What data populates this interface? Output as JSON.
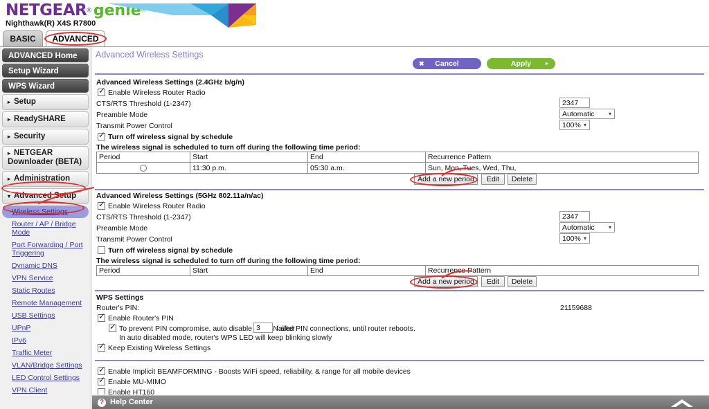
{
  "brand": {
    "netgear": "NETGEAR",
    "reg": "®",
    "genie": "genie",
    "genie_reg": "®",
    "model": "Nighthawk(R) X4S R7800",
    "purple": "#6c2f91",
    "green": "#5cb531"
  },
  "tabs": [
    {
      "label": "BASIC",
      "active": false
    },
    {
      "label": "ADVANCED",
      "active": true
    }
  ],
  "sidebar": {
    "buttons": [
      {
        "label": "ADVANCED Home"
      },
      {
        "label": "Setup Wizard"
      },
      {
        "label": "WPS Wizard"
      }
    ],
    "groups": [
      {
        "label": "Setup",
        "arrow": "▸",
        "expanded": false
      },
      {
        "label": "ReadySHARE",
        "arrow": "▸",
        "expanded": false
      },
      {
        "label": "Security",
        "arrow": "▸",
        "expanded": false
      },
      {
        "label": "NETGEAR Downloader (BETA)",
        "arrow": "▸",
        "expanded": false
      },
      {
        "label": "Administration",
        "arrow": "▸",
        "expanded": false
      },
      {
        "label": "Advanced Setup",
        "arrow": "▾",
        "expanded": true
      }
    ],
    "sub_items": [
      {
        "label": "Wireless Settings",
        "active": true
      },
      {
        "label": "Router / AP / Bridge Mode",
        "active": false
      },
      {
        "label": "Port Forwarding / Port Triggering",
        "active": false
      },
      {
        "label": "Dynamic DNS",
        "active": false
      },
      {
        "label": "VPN Service",
        "active": false
      },
      {
        "label": "Static Routes",
        "active": false
      },
      {
        "label": "Remote Management",
        "active": false
      },
      {
        "label": "USB Settings",
        "active": false
      },
      {
        "label": "UPnP",
        "active": false
      },
      {
        "label": "IPv6",
        "active": false
      },
      {
        "label": "Traffic Meter",
        "active": false
      },
      {
        "label": "VLAN/Bridge Settings",
        "active": false
      },
      {
        "label": "LED Control Settings",
        "active": false
      },
      {
        "label": "VPN Client",
        "active": false
      }
    ]
  },
  "page": {
    "title": "Advanced Wireless Settings",
    "cancel_label": "Cancel",
    "cancel_icon": "✖",
    "apply_label": "Apply",
    "apply_icon": "▸",
    "accent_purple": "#8d86c9",
    "cancel_color": "#6f64c4",
    "apply_color": "#7bba2e"
  },
  "band24": {
    "heading": "Advanced Wireless Settings (2.4GHz b/g/n)",
    "enable_radio": {
      "label": "Enable Wireless Router Radio",
      "checked": true
    },
    "cts_rts": {
      "label": "CTS/RTS Threshold (1-2347)",
      "value": "2347"
    },
    "preamble": {
      "label": "Preamble Mode",
      "value": "Automatic"
    },
    "power": {
      "label": "Transmit Power Control",
      "value": "100%"
    },
    "schedule_toggle": {
      "label": "Turn off wireless signal by schedule",
      "checked": true
    },
    "schedule_note": "The wireless signal is scheduled to turn off during the following time period:",
    "table": {
      "headers": [
        "Period",
        "Start",
        "End",
        "Recurrence Pattern"
      ],
      "rows": [
        {
          "period": "",
          "start": "11:30 p.m.",
          "end": "05:30 a.m.",
          "recurrence": "Sun, Mon, Tues, Wed, Thu,"
        }
      ]
    },
    "buttons": {
      "add": "Add a new period",
      "edit": "Edit",
      "delete": "Delete"
    }
  },
  "band5": {
    "heading": "Advanced Wireless Settings (5GHz 802.11a/n/ac)",
    "enable_radio": {
      "label": "Enable Wireless Router Radio",
      "checked": true
    },
    "cts_rts": {
      "label": "CTS/RTS Threshold (1-2347)",
      "value": "2347"
    },
    "preamble": {
      "label": "Preamble Mode",
      "value": "Automatic"
    },
    "power": {
      "label": "Transmit Power Control",
      "value": "100%"
    },
    "schedule_toggle": {
      "label": "Turn off wireless signal by schedule",
      "checked": false
    },
    "schedule_note": "The wireless signal is scheduled to turn off during the following time period:",
    "table": {
      "headers": [
        "Period",
        "Start",
        "End",
        "Recurrence Pattern"
      ],
      "rows": []
    },
    "buttons": {
      "add": "Add a new period",
      "edit": "Edit",
      "delete": "Delete"
    }
  },
  "wps": {
    "heading": "WPS Settings",
    "pin_label": "Router's PIN:",
    "pin_value": "21159688",
    "enable_pin": {
      "label": "Enable Router's PIN",
      "checked": true
    },
    "auto_disable": {
      "checked": true,
      "text_before": "To prevent PIN compromise, auto disable the PIN after",
      "value": "3",
      "text_after": "failed PIN connections, until router reboots."
    },
    "blink_note": "In auto disabled mode, router's WPS LED will keep blinking slowly",
    "keep_settings": {
      "label": "Keep Existing Wireless Settings",
      "checked": true
    }
  },
  "features": [
    {
      "label": "Enable Implicit BEAMFORMING - Boosts WiFi speed, reliability, & range for all mobile devices",
      "checked": true
    },
    {
      "label": "Enable MU-MIMO",
      "checked": true
    },
    {
      "label": "Enable HT160",
      "checked": false
    }
  ],
  "help": {
    "label": "Help Center",
    "icon": "?",
    "chevron": "▲"
  }
}
